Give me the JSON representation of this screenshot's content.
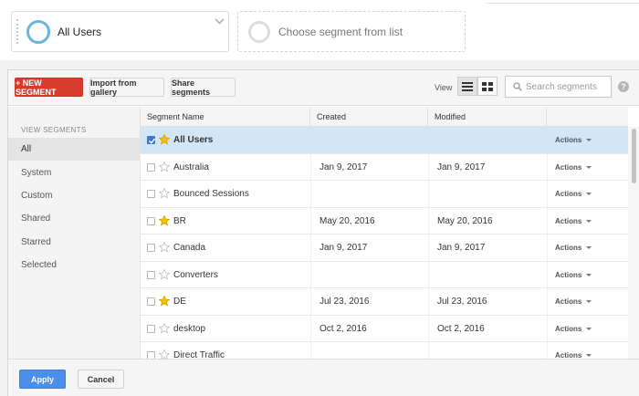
{
  "segment_bar": {
    "active_segment": "All Users",
    "empty_slot": "Choose segment from list"
  },
  "toolbar": {
    "new_segment": "+ NEW SEGMENT",
    "import": "Import from gallery",
    "share": "Share segments",
    "view_label": "View",
    "search_placeholder": "Search segments",
    "help": "?"
  },
  "sidebar": {
    "title": "VIEW SEGMENTS",
    "items": [
      {
        "label": "All",
        "selected": true
      },
      {
        "label": "System"
      },
      {
        "label": "Custom"
      },
      {
        "label": "Shared"
      },
      {
        "label": "Starred"
      },
      {
        "label": "Selected"
      }
    ]
  },
  "table": {
    "columns": [
      "Segment Name",
      "Created",
      "Modified"
    ],
    "actions_label": "Actions",
    "rows": [
      {
        "name": "All Users",
        "created": "",
        "modified": "",
        "checked": true,
        "starred": true
      },
      {
        "name": "Australia",
        "created": "Jan 9, 2017",
        "modified": "Jan 9, 2017",
        "checked": false,
        "starred": false
      },
      {
        "name": "Bounced Sessions",
        "created": "",
        "modified": "",
        "checked": false,
        "starred": false
      },
      {
        "name": "BR",
        "created": "May 20, 2016",
        "modified": "May 20, 2016",
        "checked": false,
        "starred": true
      },
      {
        "name": "Canada",
        "created": "Jan 9, 2017",
        "modified": "Jan 9, 2017",
        "checked": false,
        "starred": false
      },
      {
        "name": "Converters",
        "created": "",
        "modified": "",
        "checked": false,
        "starred": false
      },
      {
        "name": "DE",
        "created": "Jul 23, 2016",
        "modified": "Jul 23, 2016",
        "checked": false,
        "starred": true
      },
      {
        "name": "desktop",
        "created": "Oct 2, 2016",
        "modified": "Oct 2, 2016",
        "checked": false,
        "starred": false
      },
      {
        "name": "Direct Traffic",
        "created": "",
        "modified": "",
        "checked": false,
        "starred": false
      }
    ]
  },
  "footer": {
    "apply": "Apply",
    "cancel": "Cancel"
  },
  "colors": {
    "new_segment": "#d73c2c",
    "apply": "#4c8fe8",
    "selected_row": "#d3e6f5",
    "star": "#f4c20d"
  }
}
